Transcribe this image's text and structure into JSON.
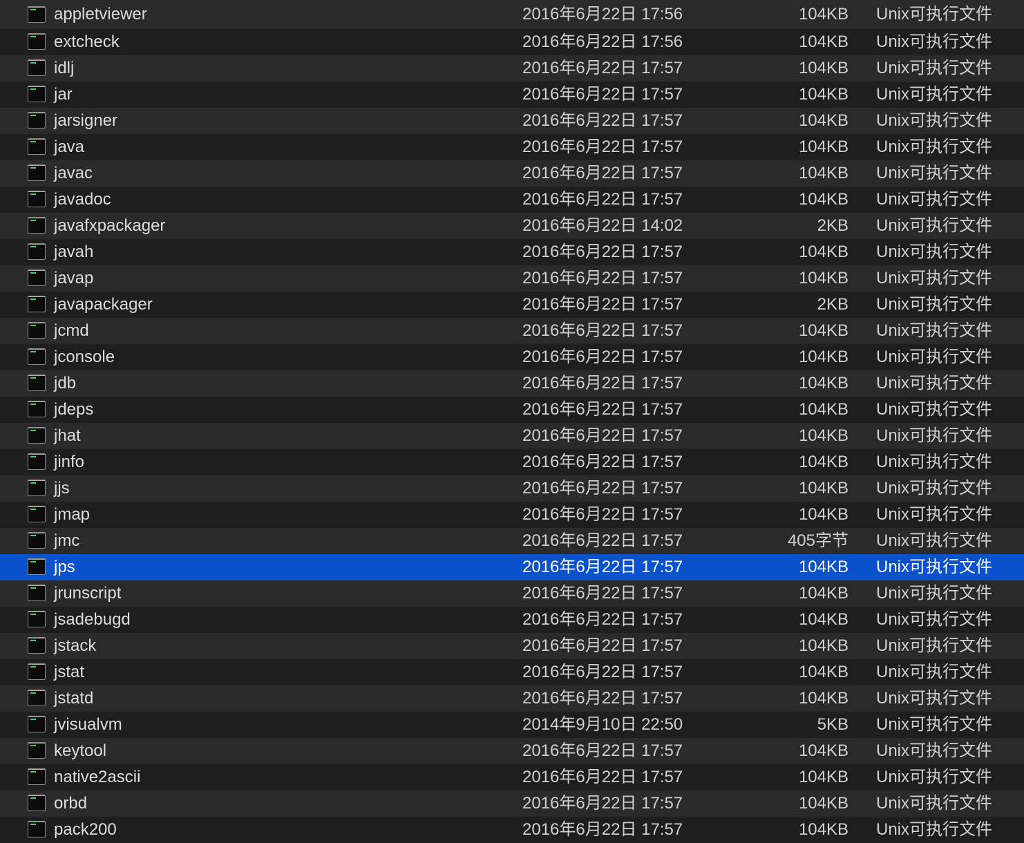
{
  "colors": {
    "background": "#1e1e1e",
    "row_alt": "#2a2a2a",
    "selection": "#0a52cc",
    "text": "#dcdcdc",
    "icon_prompt": "#3fd24a"
  },
  "files": [
    {
      "name": "appletviewer",
      "date": "2016年6月22日 17:56",
      "size": "104KB",
      "kind": "Unix可执行文件",
      "icon": "terminal-exec-icon"
    },
    {
      "name": "extcheck",
      "date": "2016年6月22日 17:56",
      "size": "104KB",
      "kind": "Unix可执行文件",
      "icon": "terminal-exec-icon"
    },
    {
      "name": "idlj",
      "date": "2016年6月22日 17:57",
      "size": "104KB",
      "kind": "Unix可执行文件",
      "icon": "terminal-exec-icon"
    },
    {
      "name": "jar",
      "date": "2016年6月22日 17:57",
      "size": "104KB",
      "kind": "Unix可执行文件",
      "icon": "terminal-exec-icon"
    },
    {
      "name": "jarsigner",
      "date": "2016年6月22日 17:57",
      "size": "104KB",
      "kind": "Unix可执行文件",
      "icon": "terminal-exec-icon"
    },
    {
      "name": "java",
      "date": "2016年6月22日 17:57",
      "size": "104KB",
      "kind": "Unix可执行文件",
      "icon": "terminal-exec-icon"
    },
    {
      "name": "javac",
      "date": "2016年6月22日 17:57",
      "size": "104KB",
      "kind": "Unix可执行文件",
      "icon": "terminal-exec-icon"
    },
    {
      "name": "javadoc",
      "date": "2016年6月22日 17:57",
      "size": "104KB",
      "kind": "Unix可执行文件",
      "icon": "terminal-exec-icon"
    },
    {
      "name": "javafxpackager",
      "date": "2016年6月22日 14:02",
      "size": "2KB",
      "kind": "Unix可执行文件",
      "icon": "terminal-exec-icon"
    },
    {
      "name": "javah",
      "date": "2016年6月22日 17:57",
      "size": "104KB",
      "kind": "Unix可执行文件",
      "icon": "terminal-exec-icon"
    },
    {
      "name": "javap",
      "date": "2016年6月22日 17:57",
      "size": "104KB",
      "kind": "Unix可执行文件",
      "icon": "terminal-exec-icon"
    },
    {
      "name": "javapackager",
      "date": "2016年6月22日 17:57",
      "size": "2KB",
      "kind": "Unix可执行文件",
      "icon": "terminal-exec-icon"
    },
    {
      "name": "jcmd",
      "date": "2016年6月22日 17:57",
      "size": "104KB",
      "kind": "Unix可执行文件",
      "icon": "terminal-exec-icon"
    },
    {
      "name": "jconsole",
      "date": "2016年6月22日 17:57",
      "size": "104KB",
      "kind": "Unix可执行文件",
      "icon": "terminal-exec-icon"
    },
    {
      "name": "jdb",
      "date": "2016年6月22日 17:57",
      "size": "104KB",
      "kind": "Unix可执行文件",
      "icon": "terminal-exec-icon"
    },
    {
      "name": "jdeps",
      "date": "2016年6月22日 17:57",
      "size": "104KB",
      "kind": "Unix可执行文件",
      "icon": "terminal-exec-icon"
    },
    {
      "name": "jhat",
      "date": "2016年6月22日 17:57",
      "size": "104KB",
      "kind": "Unix可执行文件",
      "icon": "terminal-exec-icon"
    },
    {
      "name": "jinfo",
      "date": "2016年6月22日 17:57",
      "size": "104KB",
      "kind": "Unix可执行文件",
      "icon": "terminal-exec-icon"
    },
    {
      "name": "jjs",
      "date": "2016年6月22日 17:57",
      "size": "104KB",
      "kind": "Unix可执行文件",
      "icon": "terminal-exec-icon"
    },
    {
      "name": "jmap",
      "date": "2016年6月22日 17:57",
      "size": "104KB",
      "kind": "Unix可执行文件",
      "icon": "terminal-exec-icon"
    },
    {
      "name": "jmc",
      "date": "2016年6月22日 17:57",
      "size": "405字节",
      "kind": "Unix可执行文件",
      "icon": "terminal-exec-icon"
    },
    {
      "name": "jps",
      "date": "2016年6月22日 17:57",
      "size": "104KB",
      "kind": "Unix可执行文件",
      "icon": "terminal-exec-icon",
      "selected": true
    },
    {
      "name": "jrunscript",
      "date": "2016年6月22日 17:57",
      "size": "104KB",
      "kind": "Unix可执行文件",
      "icon": "terminal-exec-icon"
    },
    {
      "name": "jsadebugd",
      "date": "2016年6月22日 17:57",
      "size": "104KB",
      "kind": "Unix可执行文件",
      "icon": "terminal-exec-icon"
    },
    {
      "name": "jstack",
      "date": "2016年6月22日 17:57",
      "size": "104KB",
      "kind": "Unix可执行文件",
      "icon": "terminal-exec-icon"
    },
    {
      "name": "jstat",
      "date": "2016年6月22日 17:57",
      "size": "104KB",
      "kind": "Unix可执行文件",
      "icon": "terminal-exec-icon"
    },
    {
      "name": "jstatd",
      "date": "2016年6月22日 17:57",
      "size": "104KB",
      "kind": "Unix可执行文件",
      "icon": "terminal-exec-icon"
    },
    {
      "name": "jvisualvm",
      "date": "2014年9月10日 22:50",
      "size": "5KB",
      "kind": "Unix可执行文件",
      "icon": "terminal-exec-icon"
    },
    {
      "name": "keytool",
      "date": "2016年6月22日 17:57",
      "size": "104KB",
      "kind": "Unix可执行文件",
      "icon": "terminal-exec-icon"
    },
    {
      "name": "native2ascii",
      "date": "2016年6月22日 17:57",
      "size": "104KB",
      "kind": "Unix可执行文件",
      "icon": "terminal-exec-icon"
    },
    {
      "name": "orbd",
      "date": "2016年6月22日 17:57",
      "size": "104KB",
      "kind": "Unix可执行文件",
      "icon": "terminal-exec-icon"
    },
    {
      "name": "pack200",
      "date": "2016年6月22日 17:57",
      "size": "104KB",
      "kind": "Unix可执行文件",
      "icon": "terminal-exec-icon"
    }
  ]
}
